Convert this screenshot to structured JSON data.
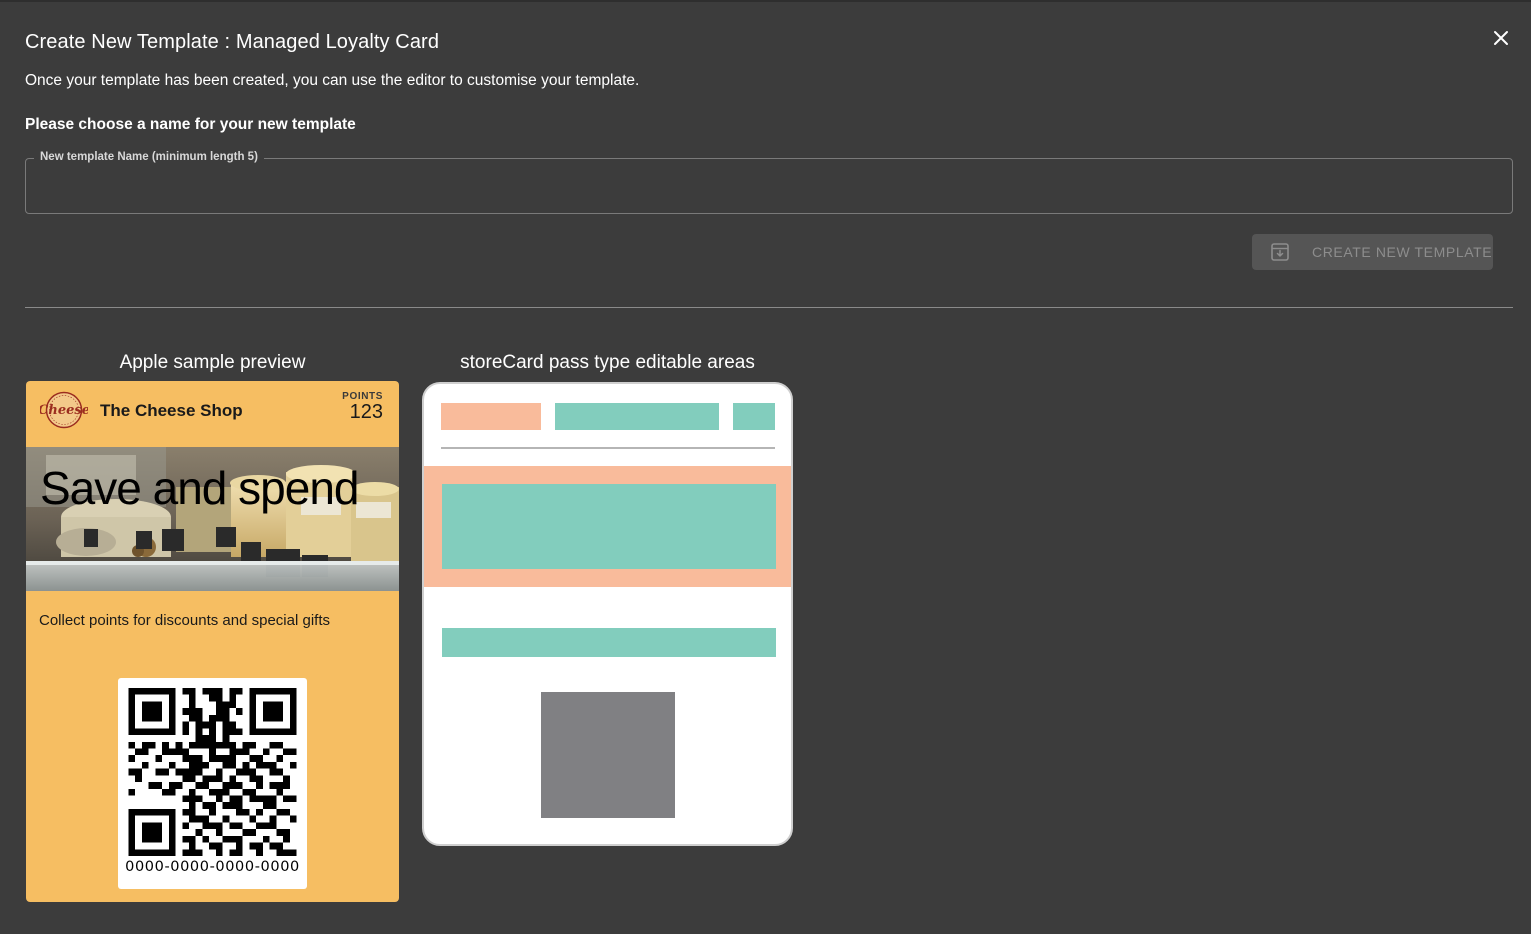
{
  "dialog": {
    "title": "Create New Template : Managed Loyalty Card",
    "subtitle": "Once your template has been created, you can use the editor to customise your template.",
    "name_section_label": "Please choose a name for your new template",
    "name_field": {
      "label": "New template Name (minimum length 5)",
      "value": ""
    },
    "create_button_label": "CREATE NEW TEMPLATE",
    "close_icon": "close-icon"
  },
  "apple_preview": {
    "heading": "Apple sample preview",
    "card": {
      "logo_text": "Cheese",
      "shop_name": "The Cheese Shop",
      "points_label": "POINTS",
      "points_value": "123",
      "strip_text": "Save and spend",
      "description": "Collect points for discounts and special gifts",
      "barcode_text": "0000-0000-0000-0000",
      "background_color": "#f6be62"
    }
  },
  "storecard_preview": {
    "heading": "storeCard pass type editable areas",
    "colors": {
      "header_accent": "#f9bb9b",
      "field": "#82cdbd",
      "barcode": "#808083"
    }
  }
}
